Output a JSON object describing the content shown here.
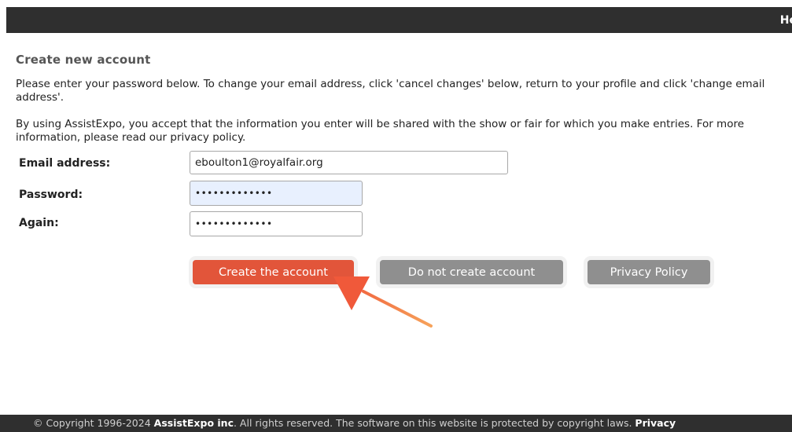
{
  "header": {
    "help_label": "He"
  },
  "page": {
    "title": "Create new account",
    "instructions": "Please enter your password below. To change your email address, click 'cancel changes' below, return to your profile and click 'change email address'.",
    "consent": "By using AssistExpo, you accept that the information you enter will be shared with the show or fair for which you make entries. For more information, please read our privacy policy."
  },
  "form": {
    "email_label": "Email address:",
    "email_value": "eboulton1@royalfair.org",
    "password_label": "Password:",
    "password_value": "•••••••••••••",
    "again_label": "Again:",
    "again_value": "•••••••••••••"
  },
  "buttons": {
    "create": "Create the account",
    "no_create": "Do not create account",
    "privacy": "Privacy Policy"
  },
  "footer": {
    "prefix": "© Copyright 1996-2024 ",
    "company": "AssistExpo inc",
    "suffix": ".  All rights reserved.  The software on this website is protected by copyright laws.  ",
    "privacy_link": "Privacy"
  },
  "colors": {
    "accent": "#e2553a",
    "secondary_button": "#8f8f8f",
    "annotation_arrow": "#f0593a"
  }
}
